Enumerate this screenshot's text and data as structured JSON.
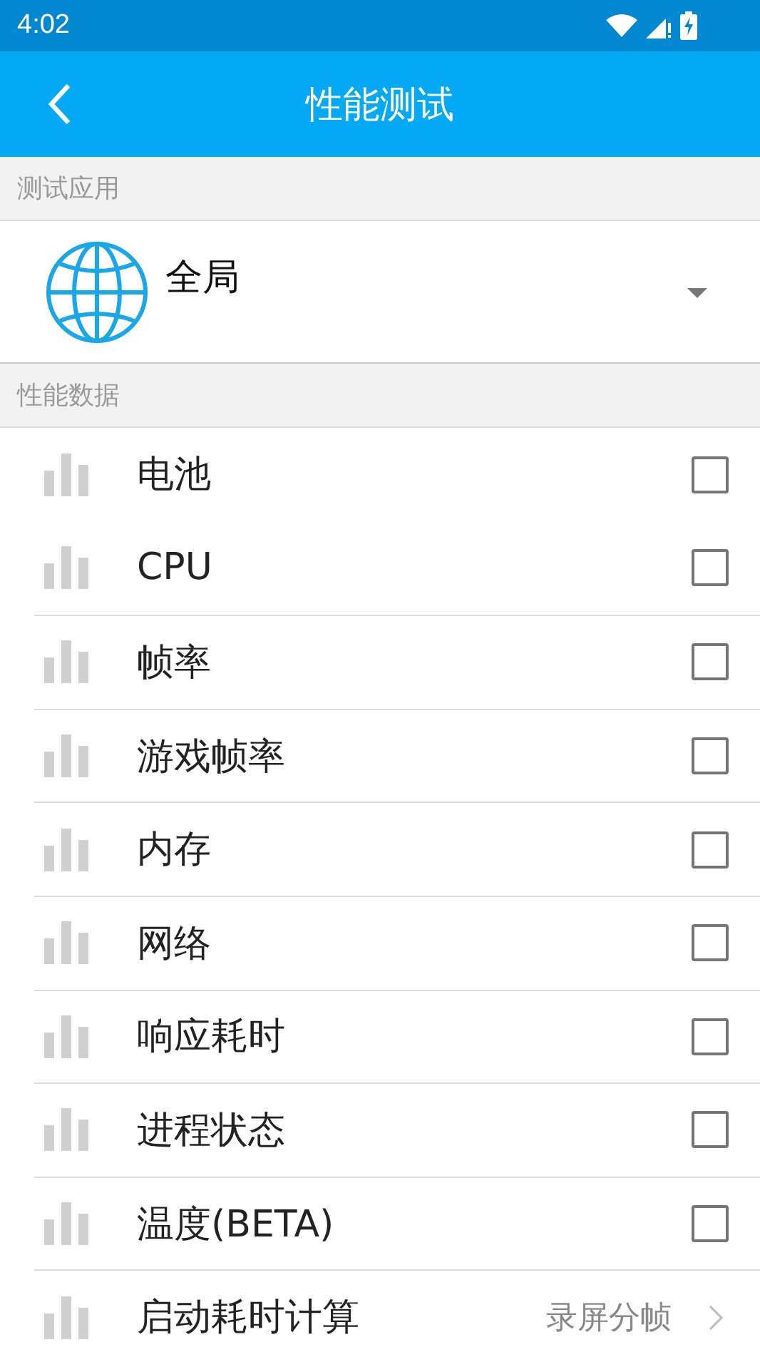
{
  "status_bar": {
    "time": "4:02"
  },
  "app_bar": {
    "title": "性能测试"
  },
  "sections": [
    {
      "header": "测试应用"
    },
    {
      "header": "性能数据"
    }
  ],
  "app_picker": {
    "value": "全局"
  },
  "metrics": [
    {
      "label": "电池",
      "checked": false
    },
    {
      "label": "CPU",
      "checked": false
    },
    {
      "label": "帧率",
      "checked": false
    },
    {
      "label": "游戏帧率",
      "checked": false
    },
    {
      "label": "内存",
      "checked": false
    },
    {
      "label": "网络",
      "checked": false
    },
    {
      "label": "响应耗时",
      "checked": false
    },
    {
      "label": "进程状态",
      "checked": false
    },
    {
      "label": "温度(BETA)",
      "checked": false
    },
    {
      "label": "启动耗时计算",
      "link": "录屏分帧"
    }
  ]
}
